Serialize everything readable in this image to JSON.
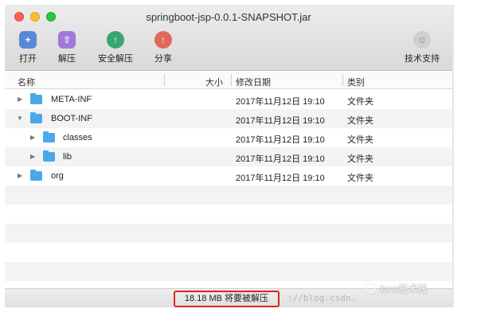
{
  "window": {
    "title": "springboot-jsp-0.0.1-SNAPSHOT.jar"
  },
  "toolbar": {
    "open": "打开",
    "extract": "解压",
    "safe_extract": "安全解压",
    "share": "分享",
    "support": "技术支持"
  },
  "columns": {
    "name": "名称",
    "size": "大小",
    "modified": "修改日期",
    "kind": "类别"
  },
  "files": [
    {
      "name": "META-INF",
      "date": "2017年11月12日 19:10",
      "kind": "文件夹"
    },
    {
      "name": "BOOT-INF",
      "date": "2017年11月12日 19:10",
      "kind": "文件夹"
    },
    {
      "name": "classes",
      "date": "2017年11月12日 19:10",
      "kind": "文件夹"
    },
    {
      "name": "lib",
      "date": "2017年11月12日 19:10",
      "kind": "文件夹"
    },
    {
      "name": "org",
      "date": "2017年11月12日 19:10",
      "kind": "文件夹"
    }
  ],
  "status": {
    "text": "18.18 MB 将要被解压"
  },
  "watermark": {
    "text": "://blog.csdn.",
    "wechat": "Java技术栈"
  }
}
